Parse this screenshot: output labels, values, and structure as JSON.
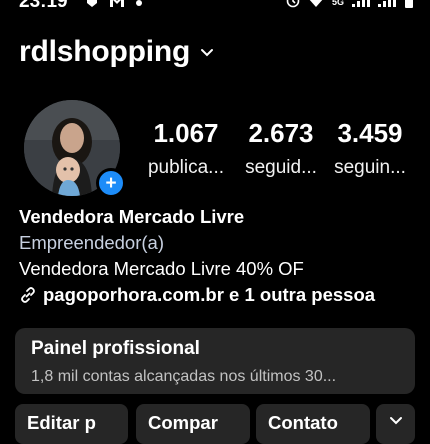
{
  "status_bar": {
    "time": "23:19",
    "right_text": "5G"
  },
  "header": {
    "username": "rdlshopping"
  },
  "stats": [
    {
      "value": "1.067",
      "label": "publica..."
    },
    {
      "value": "2.673",
      "label": "seguid..."
    },
    {
      "value": "3.459",
      "label": "seguin..."
    }
  ],
  "bio": {
    "name": "Vendedora Mercado Livre",
    "category": "Empreendedor(a)",
    "text": "Vendedora Mercado Livre 40% OF",
    "link": "pagoporhora.com.br e 1 outra pessoa"
  },
  "pro_panel": {
    "title": "Painel profissional",
    "subtitle": "1,8 mil contas alcançadas nos últimos 30..."
  },
  "actions": {
    "edit": "Editar p",
    "share": "Compar",
    "contact": "Contato"
  },
  "colors": {
    "background": "#000000",
    "panel": "#262626",
    "accent_blue": "#1d8cf8",
    "category_text": "#c7d0e0"
  }
}
